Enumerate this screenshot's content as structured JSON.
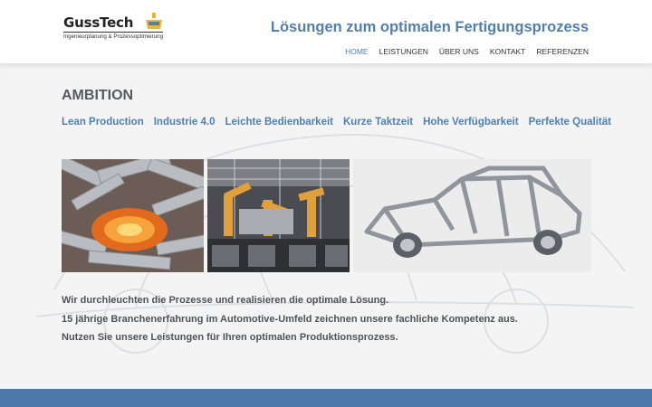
{
  "brand": {
    "name": "GussTech",
    "subtitle": "Ingenieurplanung & Prozessoptimierung",
    "accent": "#e9b824"
  },
  "header": {
    "tagline": "Lösungen zum optimalen Fertigungsprozess"
  },
  "nav": {
    "items": [
      {
        "label": "HOME",
        "active": true
      },
      {
        "label": "LEISTUNGEN",
        "active": false
      },
      {
        "label": "ÜBER UNS",
        "active": false
      },
      {
        "label": "KONTAKT",
        "active": false
      },
      {
        "label": "REFERENZEN",
        "active": false
      }
    ]
  },
  "main": {
    "heading": "AMBITION",
    "keywords": [
      "Lean Production",
      "Industrie 4.0",
      "Leichte Bedienbarkeit",
      "Kurze Taktzeit",
      "Hohe Verfügbarkeit",
      "Perfekte Qualität"
    ],
    "images": [
      {
        "name": "foundry-casting-photo"
      },
      {
        "name": "robot-assembly-line-photo"
      },
      {
        "name": "car-body-frame-photo"
      }
    ],
    "intro": [
      "Wir durchleuchten die Prozesse und realisieren die optimale Lösung.",
      "15 jährige Branchenerfahrung im Automotive-Umfeld zeichnen unsere fachliche Kompetenz aus.",
      "Nutzen Sie unsere Leistungen für Ihren optimalen Produktionsprozess."
    ]
  },
  "colors": {
    "primary": "#4f7fb4",
    "heading": "#555b63",
    "footer": "#4d78ad",
    "page_background": "#f4f4f4"
  }
}
